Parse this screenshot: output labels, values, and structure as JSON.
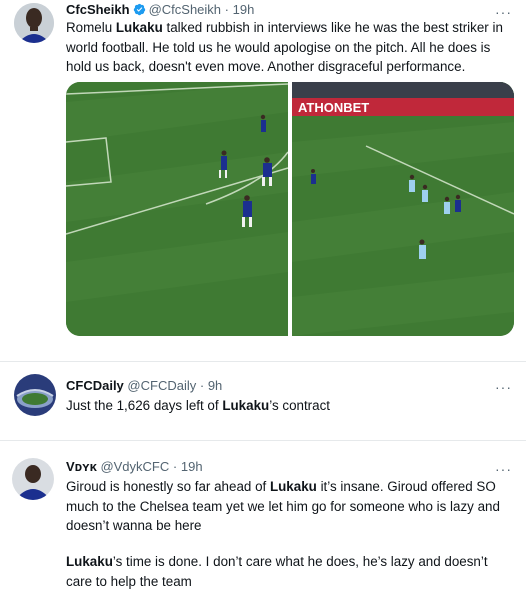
{
  "tweets": [
    {
      "name": "CfcSheikh",
      "handle": "@CfcSheikh",
      "dot": "·",
      "time": "19h",
      "text_a": "Romelu ",
      "text_b": "Lukaku",
      "text_c": " talked rubbish in interviews like he was the best striker in world football. He told us he would apologise on the pitch. All he does is hold us back, doesn't even move. Another disgraceful performance.",
      "media_banner": "ATHONBET"
    },
    {
      "name": "CFCDaily",
      "handle": "@CFCDaily",
      "dot": "·",
      "time": "9h",
      "text_a": "Just the 1,626 days left of ",
      "text_b": "Lukaku",
      "text_c": "’s contract"
    },
    {
      "name": "Vᴅʏᴋ",
      "handle": "@VdykCFC",
      "dot": "·",
      "time": "19h",
      "p1_a": "Giroud is honestly so far ahead of ",
      "p1_b": "Lukaku",
      "p1_c": " it’s insane. Giroud offered SO much to the Chelsea team yet we let him go for someone who is lazy and doesn’t wanna be here",
      "p2_a": "Lukaku",
      "p2_b": "’s time is done. I don’t care what he does, he’s lazy and doesn’t care to help the team"
    }
  ],
  "more_label": "···",
  "colors": {
    "verified": "#1d9bf0",
    "pitch": "#3e7a32",
    "chelsea": "#1b2f8f",
    "city": "#9ed0ef"
  },
  "icons": [
    "verified-badge-icon",
    "more-options-icon"
  ]
}
